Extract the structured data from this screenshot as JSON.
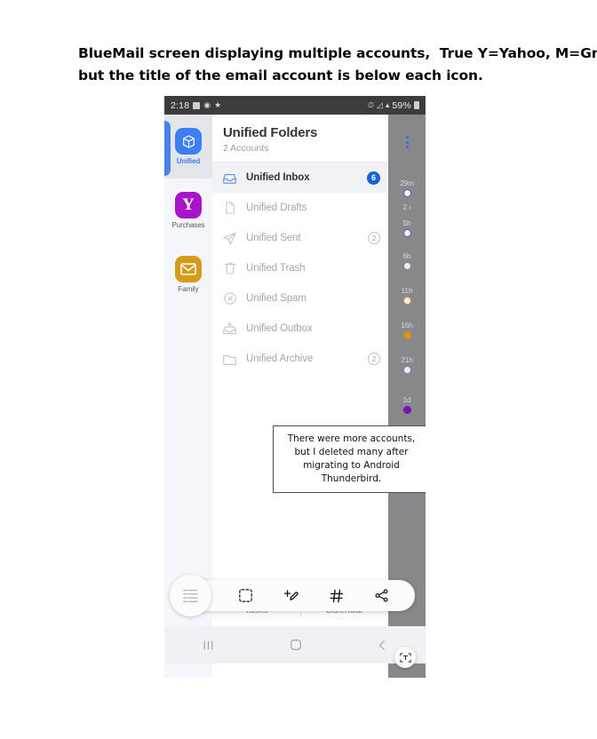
{
  "caption": {
    "line1": "BlueMail screen displaying multiple accounts,  True Y=Yahoo, M=Gmail,",
    "line2": "but the title of the email account is below each icon."
  },
  "status_bar": {
    "time": "2:18",
    "left_icons": [
      "image-icon",
      "settings-icon",
      "star-icon"
    ],
    "right_icons": [
      "alarm-icon",
      "wifi-icon",
      "signal-icon"
    ],
    "battery_percent": "59%"
  },
  "account_rail": {
    "items": [
      {
        "label": "Unified",
        "icon": "cube-icon",
        "color": "#3d7ff0",
        "glyph": "",
        "active": true
      },
      {
        "label": "Purchases",
        "icon": "yahoo-icon",
        "color": "#a815c8",
        "glyph": "Y",
        "active": false
      },
      {
        "label": "Family",
        "icon": "gmail-icon",
        "color": "#d79b1b",
        "glyph": "M",
        "active": false
      }
    ]
  },
  "panel": {
    "title": "Unified Folders",
    "subtitle": "2 Accounts",
    "overflow_menu": "more-options",
    "folders": [
      {
        "label": "Unified Inbox",
        "icon": "inbox-icon",
        "badge": "6",
        "badge_style": "filled",
        "selected": true
      },
      {
        "label": "Unified Drafts",
        "icon": "draft-icon",
        "badge": "",
        "badge_style": "none",
        "selected": false
      },
      {
        "label": "Unified Sent",
        "icon": "send-icon",
        "badge": "2",
        "badge_style": "outlined",
        "selected": false
      },
      {
        "label": "Unified Trash",
        "icon": "trash-icon",
        "badge": "",
        "badge_style": "none",
        "selected": false
      },
      {
        "label": "Unified Spam",
        "icon": "spam-icon",
        "badge": "",
        "badge_style": "none",
        "selected": false
      },
      {
        "label": "Unified Outbox",
        "icon": "outbox-icon",
        "badge": "",
        "badge_style": "none",
        "selected": false
      },
      {
        "label": "Unified Archive",
        "icon": "archive-icon",
        "badge": "2",
        "badge_style": "outlined",
        "selected": false
      }
    ]
  },
  "annotation": {
    "text": "There were more accounts, but I deleted many after migrating to Android Thunderbird."
  },
  "right_strip": {
    "entries": [
      {
        "label": "29m",
        "dot_color": "#f2eef8",
        "ring_color": "#6a4fa0",
        "filled": false
      },
      {
        "label": "2 ›",
        "dot_color": "",
        "ring_color": "",
        "filled": null
      },
      {
        "label": "5h",
        "dot_color": "#f2eef8",
        "ring_color": "#6a4fa0",
        "filled": false
      },
      {
        "label": "6h",
        "dot_color": "#f2eef8",
        "ring_color": "#8d7ab5",
        "filled": false
      },
      {
        "label": "11h",
        "dot_color": "#f7f1e4",
        "ring_color": "#c79a4a",
        "filled": false
      },
      {
        "label": "16h",
        "dot_color": "#d99314",
        "ring_color": "#d99314",
        "filled": true
      },
      {
        "label": "21h",
        "dot_color": "#f2eef8",
        "ring_color": "#8d7ab5",
        "filled": false
      },
      {
        "label": "1d",
        "dot_color": "#7a0fb5",
        "ring_color": "#7a0fb5",
        "filled": true
      }
    ]
  },
  "scan_fab": {
    "icon": "text-scan-icon",
    "label": "T"
  },
  "bottom_tabs": {
    "items": [
      {
        "label": "Tasks"
      },
      {
        "label": "Calendar"
      }
    ]
  },
  "pill_toolbar": {
    "handle_icon": "list-handle-icon",
    "icons": [
      {
        "name": "text-select-icon"
      },
      {
        "name": "edit-crop-icon"
      },
      {
        "name": "hashtag-icon"
      },
      {
        "name": "share-icon"
      }
    ]
  },
  "nav_bar": {
    "recents": "recents-icon",
    "home": "home-icon",
    "back": "back-icon"
  }
}
